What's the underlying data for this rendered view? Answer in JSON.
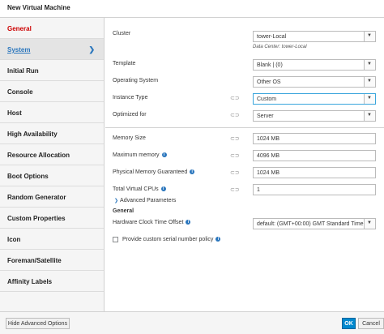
{
  "window": {
    "title": "New Virtual Machine"
  },
  "sidebar": {
    "items": [
      {
        "label": "General",
        "state": "error"
      },
      {
        "label": "System",
        "state": "active"
      },
      {
        "label": "Initial Run"
      },
      {
        "label": "Console"
      },
      {
        "label": "Host"
      },
      {
        "label": "High Availability"
      },
      {
        "label": "Resource Allocation"
      },
      {
        "label": "Boot Options"
      },
      {
        "label": "Random Generator"
      },
      {
        "label": "Custom Properties"
      },
      {
        "label": "Icon"
      },
      {
        "label": "Foreman/Satellite"
      },
      {
        "label": "Affinity Labels"
      }
    ],
    "chevron": "chevron-right-icon"
  },
  "form": {
    "cluster": {
      "label": "Cluster",
      "value": "tower-Local",
      "sub": "Data Center: tower-Local"
    },
    "template": {
      "label": "Template",
      "value": "Blank | (0)"
    },
    "os": {
      "label": "Operating System",
      "value": "Other OS"
    },
    "instance_type": {
      "label": "Instance Type",
      "value": "Custom"
    },
    "optimized": {
      "label": "Optimized for",
      "value": "Server"
    },
    "memory_size": {
      "label": "Memory Size",
      "value": "1024 MB"
    },
    "max_memory": {
      "label": "Maximum memory",
      "value": "4096 MB"
    },
    "phys_memory": {
      "label": "Physical Memory Guaranteed",
      "value": "1024 MB"
    },
    "vcpus": {
      "label": "Total Virtual CPUs",
      "value": "1"
    },
    "advanced": {
      "label": "Advanced Parameters"
    },
    "general_heading": "General",
    "clock": {
      "label": "Hardware Clock Time Offset",
      "value": "default: (GMT+00:00) GMT Standard Time"
    },
    "serial": {
      "label": "Provide custom serial number policy",
      "checked": false
    },
    "info_glyph": "i",
    "caret_glyph": "▼",
    "link_glyph": "⊂⊃",
    "advanced_arrow": "❯"
  },
  "footer": {
    "hide_advanced": "Hide Advanced Options",
    "ok": "OK",
    "cancel": "Cancel"
  },
  "colors": {
    "accent": "#0088ce",
    "error": "#cc0000",
    "link": "#2a76bd"
  }
}
